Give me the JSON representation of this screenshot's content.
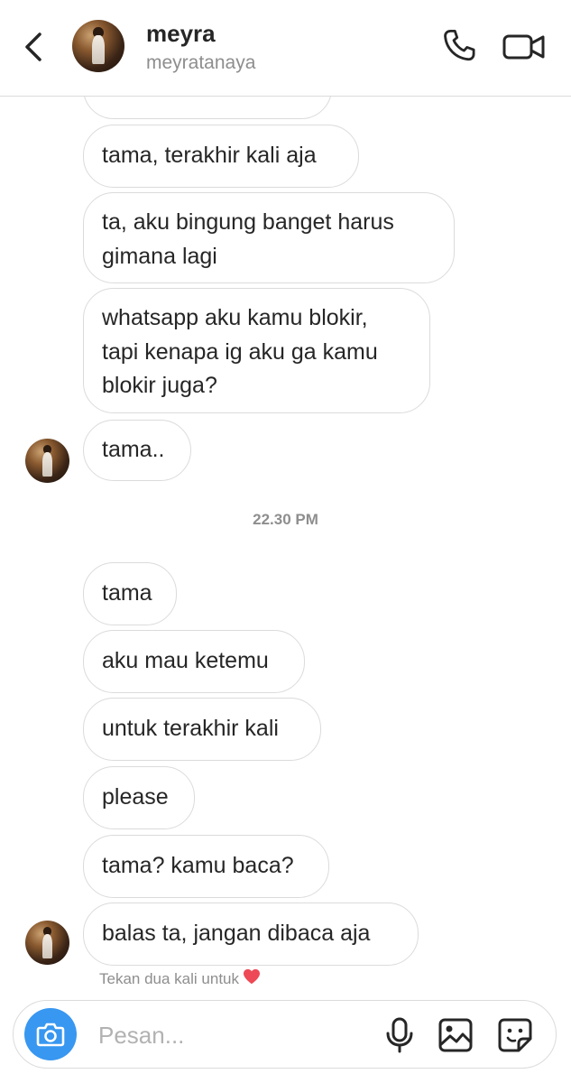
{
  "header": {
    "name": "meyra",
    "username": "meyratanaya"
  },
  "messages": [
    {
      "text": "tama, terakhir kali aja"
    },
    {
      "text": "ta, aku bingung banget harus\ngimana lagi"
    },
    {
      "text": "whatsapp aku kamu blokir,\ntapi kenapa ig aku ga kamu\nblokir juga?"
    },
    {
      "text": "tama.."
    },
    {
      "text": "tama"
    },
    {
      "text": "aku mau ketemu"
    },
    {
      "text": "untuk terakhir kali"
    },
    {
      "text": "please"
    },
    {
      "text": "tama? kamu baca?"
    },
    {
      "text": "balas ta, jangan dibaca aja"
    }
  ],
  "timestamp": "22.30 PM",
  "like_hint": "Tekan dua kali untuk",
  "composer": {
    "placeholder": "Pesan..."
  },
  "colors": {
    "accent": "#3897f0",
    "bubble_border": "#dbdbdb",
    "muted_text": "#8e8e8e",
    "heart": "#ed4956"
  },
  "icons": [
    "back-icon",
    "phone-icon",
    "video-icon",
    "camera-icon",
    "microphone-icon",
    "gallery-icon",
    "sticker-icon",
    "heart-icon"
  ]
}
